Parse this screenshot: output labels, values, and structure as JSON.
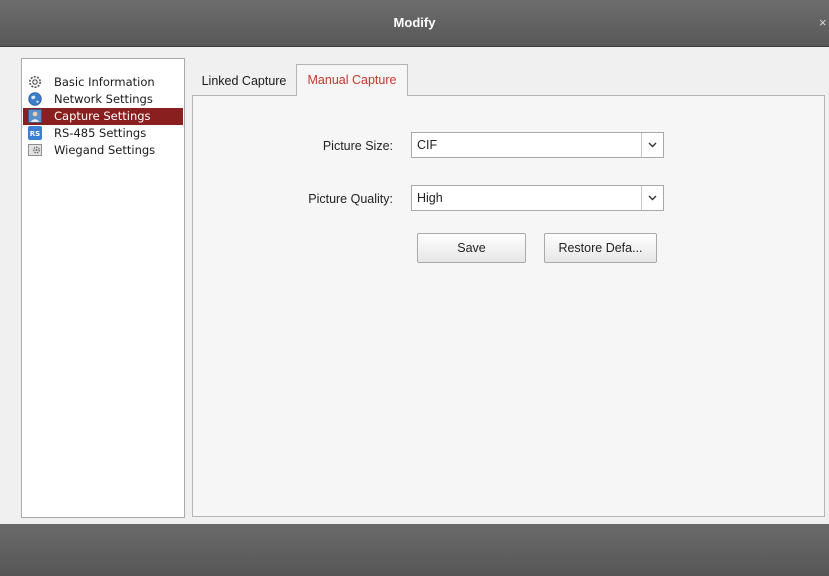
{
  "window": {
    "title": "Modify",
    "close_glyph": "×"
  },
  "sidebar": {
    "items": [
      {
        "label": "Basic Information",
        "icon": "basic-information-icon",
        "selected": false
      },
      {
        "label": "Network Settings",
        "icon": "network-globe-icon",
        "selected": false
      },
      {
        "label": "Capture Settings",
        "icon": "capture-person-icon",
        "selected": true
      },
      {
        "label": "RS-485 Settings",
        "icon": "rs-485-icon",
        "selected": false
      },
      {
        "label": "Wiegand Settings",
        "icon": "wiegand-icon",
        "selected": false
      }
    ],
    "rs_badge": "RS"
  },
  "tabs": [
    {
      "label": "Linked Capture",
      "active": false
    },
    {
      "label": "Manual Capture",
      "active": true
    }
  ],
  "form": {
    "picture_size": {
      "label": "Picture Size:",
      "value": "CIF"
    },
    "picture_quality": {
      "label": "Picture Quality:",
      "value": "High"
    }
  },
  "buttons": {
    "save": "Save",
    "restore": "Restore Defa..."
  },
  "colors": {
    "selected_bg": "#8a1f1f",
    "active_tab_text": "#c0392b",
    "title_bar": "#636363"
  }
}
